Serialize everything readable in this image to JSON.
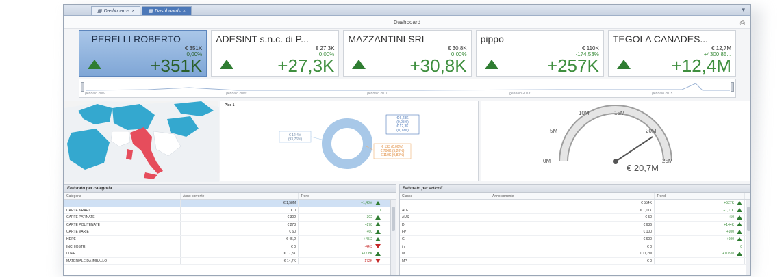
{
  "tabs": [
    {
      "label": "Dashboards"
    },
    {
      "label": "Dashboards"
    }
  ],
  "dashboard": {
    "title": "Dashboard"
  },
  "cards": [
    {
      "name": "_ PERELLI ROBERTO",
      "value": "€ 351K",
      "pct": "0,00%",
      "big": "+351K",
      "selected": true
    },
    {
      "name": "ADESINT s.n.c. di P...",
      "value": "€ 27,3K",
      "pct": "0,00%",
      "big": "+27,3K",
      "selected": false
    },
    {
      "name": "MAZZANTINI SRL",
      "value": "€ 30,8K",
      "pct": "0,00%",
      "big": "+30,8K",
      "selected": false
    },
    {
      "name": "pippo",
      "value": "€ 110K",
      "pct": "-174,53%",
      "big": "+257K",
      "selected": false
    },
    {
      "name": "TEGOLA CANADES...",
      "value": "€ 12,7M",
      "pct": "+4300,85...",
      "big": "+12,4M",
      "selected": false
    }
  ],
  "timeline": {
    "labels": [
      "gennaio 2007",
      "gennaio 2009",
      "gennaio 2011",
      "gennaio 2013",
      "gennaio 2015"
    ]
  },
  "pies": {
    "title": "Pies 1",
    "left_label_1": "€ 12,4M",
    "left_label_2": "(93,76%)",
    "right_labels": [
      "€ 6,23K",
      "(0,05%)",
      "€ 12,3K",
      "(0,09%)"
    ],
    "orange_labels": [
      "€ 123 (0,00%)",
      "€ 700K (5,20%)",
      "€ 110K (0,83%)"
    ]
  },
  "gauge": {
    "ticks": [
      "0M",
      "5M",
      "10M",
      "15M",
      "20M",
      "25M"
    ],
    "value_label": "€ 20,7M",
    "value": 20.7,
    "max": 25
  },
  "table_left": {
    "title": "Fatturato per categoria",
    "columns": [
      "Categoria",
      "Anno corrente",
      "Trend"
    ],
    "rows": [
      {
        "cat": "",
        "val": "€ 1,58M",
        "trend": "+1,48M",
        "dir": "up",
        "sel": true
      },
      {
        "cat": "CARTE KRAFT",
        "val": "€ 0",
        "trend": "0",
        "dir": "",
        "sel": false
      },
      {
        "cat": "CARTE PATINATE",
        "val": "€ 302",
        "trend": "+302",
        "dir": "up",
        "sel": false
      },
      {
        "cat": "CARTE POLITENATE",
        "val": "€ 278",
        "trend": "+278",
        "dir": "up",
        "sel": false
      },
      {
        "cat": "CARTE VARIE",
        "val": "€ 60",
        "trend": "+60",
        "dir": "up",
        "sel": false
      },
      {
        "cat": "HDPE",
        "val": "€ 45,2",
        "trend": "+45,2",
        "dir": "up",
        "sel": false
      },
      {
        "cat": "INCHIOSTRI",
        "val": "€ 0",
        "trend": "-44,3",
        "dir": "down",
        "sel": false
      },
      {
        "cat": "LDPE",
        "val": "€ 17,8K",
        "trend": "+17,8K",
        "dir": "up",
        "sel": false
      },
      {
        "cat": "MATERIALE DA IMBALLO",
        "val": "€ 14,7K",
        "trend": "-172K",
        "dir": "down",
        "sel": false
      }
    ]
  },
  "table_right": {
    "title": "Fatturato per articoli",
    "columns": [
      "Classe",
      "Anno corrente",
      "Trend"
    ],
    "rows": [
      {
        "cat": "",
        "val": "€ 554K",
        "trend": "+527K",
        "dir": "up"
      },
      {
        "cat": "ALF",
        "val": "€ 1,11K",
        "trend": "+1,11K",
        "dir": "up"
      },
      {
        "cat": "AUS",
        "val": "€ 50",
        "trend": "+50",
        "dir": "up"
      },
      {
        "cat": "D",
        "val": "€ 636",
        "trend": "+144K",
        "dir": "up"
      },
      {
        "cat": "FP",
        "val": "€ 100",
        "trend": "+100",
        "dir": "up"
      },
      {
        "cat": "G",
        "val": "€ 600",
        "trend": "+600",
        "dir": "up"
      },
      {
        "cat": "im",
        "val": "€ 0",
        "trend": "0",
        "dir": ""
      },
      {
        "cat": "M",
        "val": "€ 11,2M",
        "trend": "+10,9M",
        "dir": "up"
      },
      {
        "cat": "MP",
        "val": "€ 0",
        "trend": "",
        "dir": ""
      }
    ]
  },
  "colors": {
    "positive": "#3f8f3f",
    "negative": "#c62828",
    "accent": "#4c78b8",
    "map_highlight": "#e64d5c",
    "map_base": "#34a8cf"
  }
}
